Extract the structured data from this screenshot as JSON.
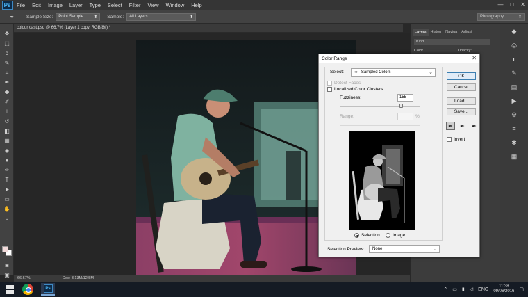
{
  "app": {
    "logo": "Ps"
  },
  "menu": [
    "File",
    "Edit",
    "Image",
    "Layer",
    "Type",
    "Select",
    "Filter",
    "View",
    "Window",
    "Help"
  ],
  "window_controls": [
    "—",
    "□",
    "✕"
  ],
  "options_bar": {
    "sample_size_label": "Sample Size:",
    "sample_size_value": "Point Sample",
    "sample_label": "Sample:",
    "sample_value": "All Layers",
    "workspace": "Photography"
  },
  "document": {
    "tab_title": "colour cast.psd @ 66.7% (Layer 1 copy, RGB/8#) *",
    "zoom": "66.67%",
    "doc_size": "Doc: 3.13M/12.5M"
  },
  "panels": {
    "tabs": [
      "Layers",
      "Histog",
      "Naviga",
      "Adjust"
    ],
    "kind": "Kind",
    "blend": "Color",
    "opacity_label": "Opacity:"
  },
  "dialog": {
    "title": "Color Range",
    "close": "✕",
    "select_label": "Select:",
    "select_value": "Sampled Colors",
    "detect_faces": "Detect Faces",
    "localized": "Localized Color Clusters",
    "fuzziness_label": "Fuzziness:",
    "fuzziness_value": "155",
    "fuzziness_fraction": 0.77,
    "range_label": "Range:",
    "range_unit": "%",
    "radio_selection": "Selection",
    "radio_image": "Image",
    "selection_preview_label": "Selection Preview:",
    "selection_preview_value": "None",
    "buttons": {
      "ok": "OK",
      "cancel": "Cancel",
      "load": "Load...",
      "save": "Save..."
    },
    "invert": "Invert"
  },
  "taskbar": {
    "language": "ENG",
    "time": "11:38",
    "date": "09/06/2016"
  }
}
